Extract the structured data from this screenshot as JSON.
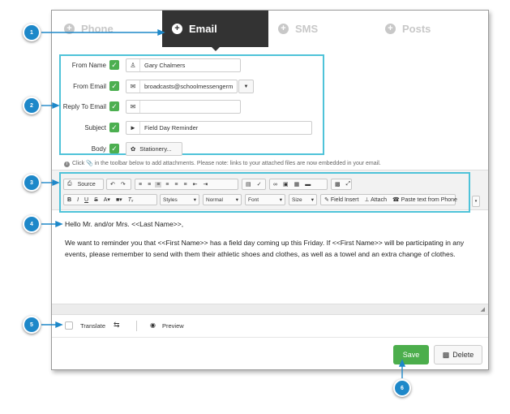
{
  "tabs": [
    {
      "label": "Phone",
      "icon": "plus-circle-icon",
      "active": false
    },
    {
      "label": "Email",
      "icon": "plus-circle-icon",
      "active": true
    },
    {
      "label": "SMS",
      "icon": "plus-circle-icon",
      "active": false
    },
    {
      "label": "Posts",
      "icon": "plus-circle-icon",
      "active": false
    }
  ],
  "form": {
    "from_name": {
      "label": "From Name",
      "value": "Gary Chalmers",
      "icon": "user-icon"
    },
    "from_email": {
      "label": "From Email",
      "value": "broadcasts@schoolmessengerm",
      "icon": "envelope-icon"
    },
    "reply_to": {
      "label": "Reply To Email",
      "value": "",
      "icon": "envelope-icon"
    },
    "subject": {
      "label": "Subject",
      "value": "Field Day Reminder",
      "icon": "megaphone-icon"
    },
    "body": {
      "label": "Body",
      "button": "Stationery...",
      "icon": "leaf-icon"
    }
  },
  "attachment_note": "Click 📎 in the toolbar below to add attachments. Please note: links to your attached files are now embedded in your email.",
  "toolbar": {
    "source": "Source",
    "styles": "Styles",
    "format": "Normal",
    "font": "Font",
    "size": "Size",
    "field_insert": "Field Insert",
    "attach": "Attach",
    "paste_phone": "Paste text from Phone"
  },
  "editor": {
    "greeting": "Hello Mr. and/or Mrs. <<Last Name>>,",
    "body": "We want to reminder you that <<First Name>> has a field day coming up this Friday. If <<First Name>> will be participating in any events, please remember to send with them their athletic shoes and clothes, as well as a towel and an extra change of clothes."
  },
  "translate": {
    "label": "Translate",
    "preview": "Preview"
  },
  "actions": {
    "save": "Save",
    "delete": "Delete"
  },
  "callouts": [
    "1",
    "2",
    "3",
    "4",
    "5",
    "6"
  ],
  "colors": {
    "accent": "#4fc3d9",
    "callout": "#1e88c9",
    "save": "#4cae4c",
    "check": "#4caf50",
    "tab_active": "#333333"
  }
}
